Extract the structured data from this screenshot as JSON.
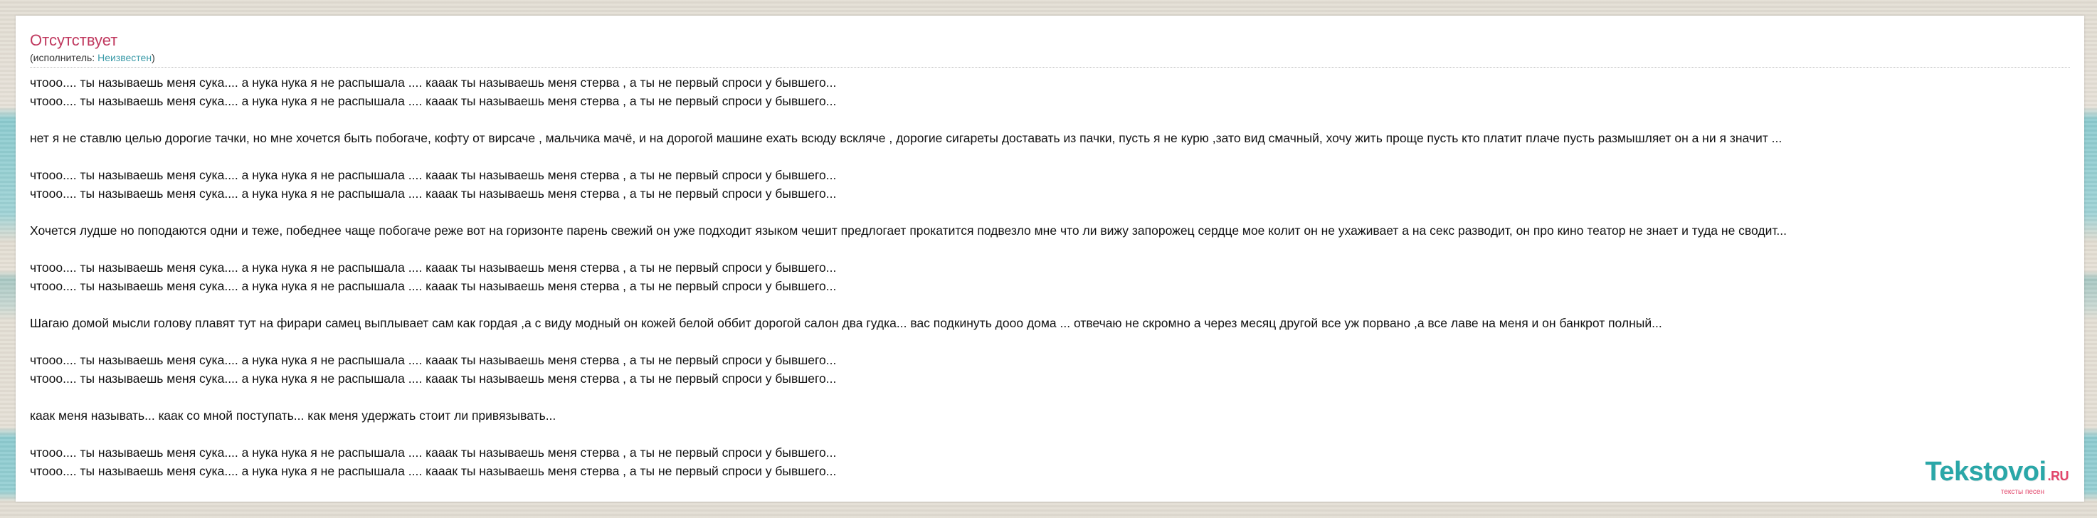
{
  "song": {
    "title": "Отсутствует",
    "performer_prefix": "(исполнитель: ",
    "performer_name": "Неизвестен",
    "performer_suffix": ")"
  },
  "lyrics": {
    "lines": [
      "чтооо.... ты называешь меня сука.... а нука нука я не распышала .... кааак ты называешь меня стерва , а ты не первый спроси у бывшего...",
      "чтооо.... ты называешь меня сука.... а нука нука я не распышала .... кааак ты называешь меня стерва , а ты не первый спроси у бывшего...",
      "",
      "нет я не ставлю целью дорогие тачки, но мне хочется быть побогаче, кофту от вирсаче , мальчика мачё, и на дорогой машине ехать всюду вскляче , дорогие сигареты доставать из пачки, пусть я не курю ,зато вид смачный, хочу жить проще пусть кто платит плаче пусть размышляет он а ни я значит ...",
      "",
      "чтооо.... ты называешь меня сука.... а нука нука я не распышала .... кааак ты называешь меня стерва , а ты не первый спроси у бывшего...",
      "чтооо.... ты называешь меня сука.... а нука нука я не распышала .... кааак ты называешь меня стерва , а ты не первый спроси у бывшего...",
      "",
      "Хочется лудше но поподаются одни и теже, победнее чаще побогаче реже вот на горизонте парень свежий он уже подходит языком чешит предлогает прокатится подвезло мне что ли вижу запорожец сердце мое колит он не ухаживает а на секс разводит, он про кино театор не знает и туда не сводит...",
      "",
      "чтооо.... ты называешь меня сука.... а нука нука я не распышала .... кааак ты называешь меня стерва , а ты не первый спроси у бывшего...",
      "чтооо.... ты называешь меня сука.... а нука нука я не распышала .... кааак ты называешь меня стерва , а ты не первый спроси у бывшего...",
      "",
      "Шагаю домой мысли голову плавят тут на фирари самец выплывает сам как гордая ,а с виду модный он кожей белой оббит дорогой салон два гудка... вас подкинуть дооо дома ... отвечаю не скромно а через месяц другой все уж порвано ,а все лаве на меня и он банкрот полный...",
      "",
      "чтооо.... ты называешь меня сука.... а нука нука я не распышала .... кааак ты называешь меня стерва , а ты не первый спроси у бывшего...",
      "чтооо.... ты называешь меня сука.... а нука нука я не распышала .... кааак ты называешь меня стерва , а ты не первый спроси у бывшего...",
      "",
      "каак меня называть... кaак со мной поступать... как меня удержать стоит ли привязывать...",
      "",
      "чтооо.... ты называешь меня сука.... а нука нука я не распышала .... кааак ты называешь меня стерва , а ты не первый спроси у бывшего...",
      "чтооо.... ты называешь меня сука.... а нука нука я не распышала .... кааак ты называешь меня стерва , а ты не первый спроси у бывшего..."
    ]
  },
  "logo": {
    "name": "Tekstovoi",
    "tld": ".RU",
    "tagline": "тексты песен"
  },
  "colors": {
    "title": "#c0395f",
    "performer_link": "#3a9aa8",
    "logo_main": "#2aa7a8",
    "logo_accent": "#e2456a"
  }
}
